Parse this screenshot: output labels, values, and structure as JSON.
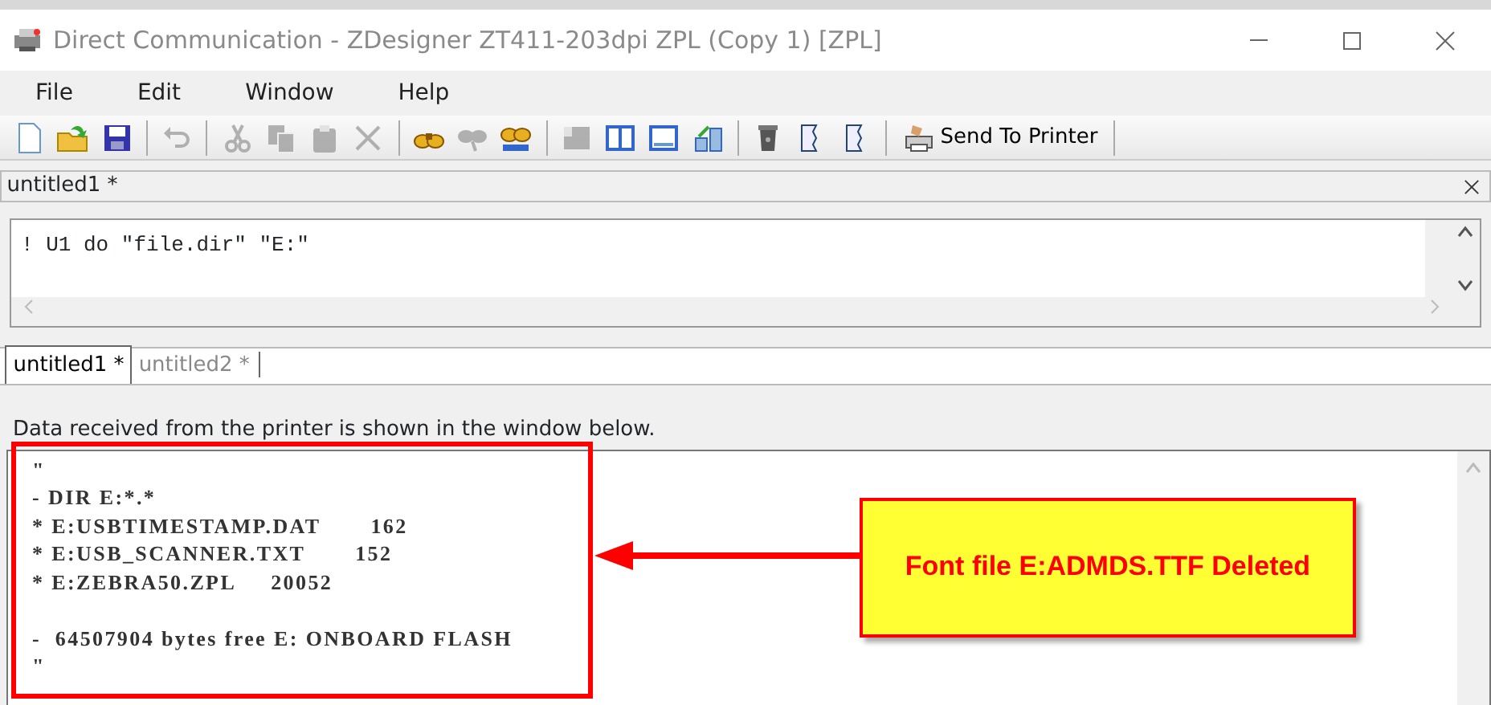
{
  "window": {
    "title": "Direct Communication - ZDesigner ZT411-203dpi ZPL (Copy 1) [ZPL]"
  },
  "menu": [
    "File",
    "Edit",
    "Window",
    "Help"
  ],
  "toolbar": [
    {
      "kind": "new",
      "disabled": false
    },
    {
      "kind": "open",
      "disabled": false
    },
    {
      "kind": "save",
      "disabled": false
    },
    {
      "kind": "sep"
    },
    {
      "kind": "undo",
      "disabled": true
    },
    {
      "kind": "sep"
    },
    {
      "kind": "cut",
      "disabled": true
    },
    {
      "kind": "copy",
      "disabled": true
    },
    {
      "kind": "paste",
      "disabled": true
    },
    {
      "kind": "delete",
      "disabled": true
    },
    {
      "kind": "sep"
    },
    {
      "kind": "find",
      "disabled": false
    },
    {
      "kind": "findnext",
      "disabled": true
    },
    {
      "kind": "replace",
      "disabled": false
    },
    {
      "kind": "sep"
    },
    {
      "kind": "panel",
      "disabled": true
    },
    {
      "kind": "columns",
      "disabled": false
    },
    {
      "kind": "window",
      "disabled": false
    },
    {
      "kind": "export",
      "disabled": false
    },
    {
      "kind": "sep"
    },
    {
      "kind": "trash",
      "disabled": false
    },
    {
      "kind": "doc",
      "disabled": false
    },
    {
      "kind": "doc",
      "disabled": false
    },
    {
      "kind": "sep"
    },
    {
      "kind": "send",
      "label": "Send To Printer",
      "disabled": false
    },
    {
      "kind": "sep"
    }
  ],
  "document": {
    "title": "untitled1 *",
    "command": "! U1 do \"file.dir\" \"E:\""
  },
  "tabs": [
    {
      "label": "untitled1 *",
      "selected": true
    },
    {
      "label": "untitled2 *",
      "selected": false
    }
  ],
  "output": {
    "caption": "Data received from the printer is shown in the window below.",
    "lines": [
      {
        "kind": "text",
        "text": "\""
      },
      {
        "kind": "text",
        "text": "- DIR E:*.*"
      },
      {
        "kind": "text",
        "text": "* E:USBTIMESTAMP.DAT       162"
      },
      {
        "kind": "text",
        "text": "* E:USB_SCANNER.TXT       152"
      },
      {
        "kind": "text",
        "text": "* E:ZEBRA50.ZPL     20052"
      },
      {
        "kind": "blank"
      },
      {
        "kind": "text",
        "text": "-  64507904 bytes free E: ONBOARD FLASH"
      },
      {
        "kind": "text",
        "text": "\""
      }
    ]
  },
  "callout": {
    "text": "Font file E:ADMDS.TTF Deleted"
  }
}
